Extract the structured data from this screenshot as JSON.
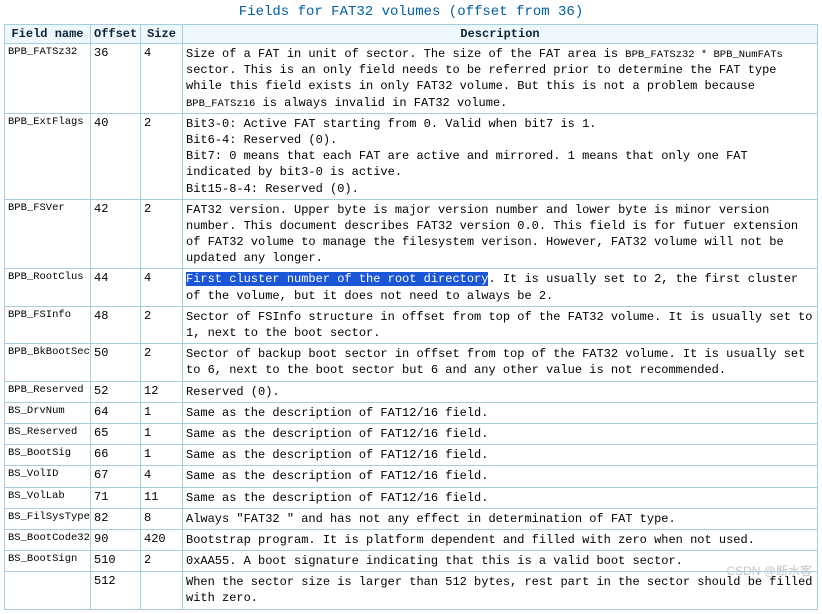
{
  "caption": "Fields for FAT32 volumes (offset from 36)",
  "headers": {
    "fieldname": "Field name",
    "offset": "Offset",
    "size": "Size",
    "description": "Description"
  },
  "rows": [
    {
      "name": "BPB_FATSz32",
      "offset": "36",
      "size": "4",
      "desc": {
        "pre": "Size of a FAT in unit of sector. The size of the FAT area is ",
        "code": "BPB_FATSz32 * BPB_NumFATs",
        "mid": " sector. This is an only field needs to be referred prior to determine the FAT type while this field exists in only FAT32 volume. But this is not a problem because ",
        "code2": "BPB_FATSz16",
        "post": " is always invalid in FAT32 volume."
      }
    },
    {
      "name": "BPB_ExtFlags",
      "offset": "40",
      "size": "2",
      "lines": [
        "Bit3-0: Active FAT starting from 0. Valid when bit7 is 1.",
        "Bit6-4: Reserved (0).",
        "Bit7: 0 means that each FAT are active and mirrored. 1 means that only one FAT indicated by bit3-0 is active.",
        "Bit15-8-4: Reserved (0)."
      ]
    },
    {
      "name": "BPB_FSVer",
      "offset": "42",
      "size": "2",
      "plain": "FAT32 version. Upper byte is major version number and lower byte is minor version number. This document describes FAT32 version 0.0. This field is for futuer extension of FAT32 volume to manage the filesystem verison. However, FAT32 volume will not be updated any longer."
    },
    {
      "name": "BPB_RootClus",
      "offset": "44",
      "size": "4",
      "hl": "First cluster number of the root directory",
      "plain_after": ". It is usually set to 2, the first cluster of the volume, but it does not need to always be 2."
    },
    {
      "name": "BPB_FSInfo",
      "offset": "48",
      "size": "2",
      "plain": "Sector of FSInfo structure in offset from top of the FAT32 volume. It is usually set to 1, next to the boot sector."
    },
    {
      "name": "BPB_BkBootSec",
      "offset": "50",
      "size": "2",
      "plain": "Sector of backup boot sector in offset from top of the FAT32 volume. It is usually set to 6, next to the boot sector but 6 and any other value is not recommended."
    },
    {
      "name": "BPB_Reserved",
      "offset": "52",
      "size": "12",
      "plain": "Reserved (0)."
    },
    {
      "name": "BS_DrvNum",
      "offset": "64",
      "size": "1",
      "plain": "Same as the description of FAT12/16 field."
    },
    {
      "name": "BS_Reserved",
      "offset": "65",
      "size": "1",
      "plain": "Same as the description of FAT12/16 field."
    },
    {
      "name": "BS_BootSig",
      "offset": "66",
      "size": "1",
      "plain": "Same as the description of FAT12/16 field."
    },
    {
      "name": "BS_VolID",
      "offset": "67",
      "size": "4",
      "plain": "Same as the description of FAT12/16 field."
    },
    {
      "name": "BS_VolLab",
      "offset": "71",
      "size": "11",
      "plain": "Same as the description of FAT12/16 field."
    },
    {
      "name": "BS_FilSysType",
      "offset": "82",
      "size": "8",
      "plain": "Always \"FAT32   \" and has not any effect in determination of FAT type."
    },
    {
      "name": "BS_BootCode32",
      "offset": "90",
      "size": "420",
      "plain": "Bootstrap program. It is platform dependent and filled with zero when not used."
    },
    {
      "name": "BS_BootSign",
      "offset": "510",
      "size": "2",
      "plain": "0xAA55. A boot signature indicating that this is a valid boot sector."
    },
    {
      "name": "",
      "offset": "512",
      "size": "",
      "plain": "When the sector size is larger than 512 bytes, rest part in the sector should be filled with zero."
    }
  ],
  "watermark": "CSDN @断水客"
}
